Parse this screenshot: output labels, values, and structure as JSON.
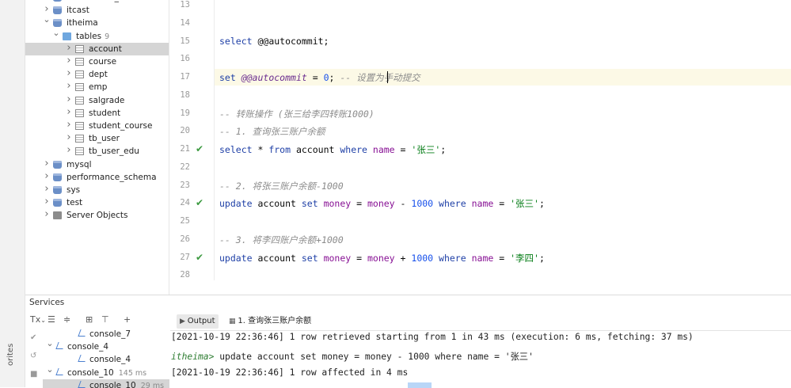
{
  "sidebar": {
    "favorites_label": "orites"
  },
  "db_tree": {
    "items": [
      {
        "label": "information_schema",
        "level": 1,
        "type": "db",
        "chevron": "›"
      },
      {
        "label": "itcast",
        "level": 1,
        "type": "db",
        "chevron": "›"
      },
      {
        "label": "itheima",
        "level": 1,
        "type": "db",
        "chevron": "⌄"
      },
      {
        "label": "tables",
        "count": "9",
        "level": 2,
        "type": "folder",
        "chevron": "⌄"
      },
      {
        "label": "account",
        "level": 3,
        "type": "table",
        "chevron": "›",
        "selected": true
      },
      {
        "label": "course",
        "level": 3,
        "type": "table",
        "chevron": "›"
      },
      {
        "label": "dept",
        "level": 3,
        "type": "table",
        "chevron": "›"
      },
      {
        "label": "emp",
        "level": 3,
        "type": "table",
        "chevron": "›"
      },
      {
        "label": "salgrade",
        "level": 3,
        "type": "table",
        "chevron": "›"
      },
      {
        "label": "student",
        "level": 3,
        "type": "table",
        "chevron": "›"
      },
      {
        "label": "student_course",
        "level": 3,
        "type": "table",
        "chevron": "›"
      },
      {
        "label": "tb_user",
        "level": 3,
        "type": "table",
        "chevron": "›"
      },
      {
        "label": "tb_user_edu",
        "level": 3,
        "type": "table",
        "chevron": "›"
      },
      {
        "label": "mysql",
        "level": 1,
        "type": "db",
        "chevron": "›"
      },
      {
        "label": "performance_schema",
        "level": 1,
        "type": "db",
        "chevron": "›"
      },
      {
        "label": "sys",
        "level": 1,
        "type": "db",
        "chevron": "›"
      },
      {
        "label": "test",
        "level": 1,
        "type": "db",
        "chevron": "›"
      },
      {
        "label": "Server Objects",
        "level": 1,
        "type": "server",
        "chevron": "›"
      }
    ]
  },
  "editor": {
    "lines": [
      {
        "n": "13",
        "check": false,
        "tokens": []
      },
      {
        "n": "14",
        "check": false,
        "tokens": []
      },
      {
        "n": "15",
        "check": false,
        "tokens": [
          {
            "t": "select ",
            "c": "kw"
          },
          {
            "t": "@@autocommit;",
            "c": ""
          }
        ]
      },
      {
        "n": "16",
        "check": false,
        "tokens": []
      },
      {
        "n": "17",
        "check": false,
        "tokens": [
          {
            "t": "set ",
            "c": "kw"
          },
          {
            "t": "@@autocommit",
            "c": "var"
          },
          {
            "t": " = ",
            "c": ""
          },
          {
            "t": "0",
            "c": "num"
          },
          {
            "t": "; ",
            "c": ""
          },
          {
            "t": "-- 设置为手动提交",
            "c": "cmt"
          }
        ]
      },
      {
        "n": "18",
        "check": false,
        "tokens": []
      },
      {
        "n": "19",
        "check": false,
        "tokens": [
          {
            "t": "-- 转账操作 (张三给李四转账1000)",
            "c": "cmt"
          }
        ]
      },
      {
        "n": "20",
        "check": false,
        "tokens": [
          {
            "t": "-- 1. 查询张三账户余额",
            "c": "cmt"
          }
        ]
      },
      {
        "n": "21",
        "check": true,
        "tokens": [
          {
            "t": "select",
            "c": "kw"
          },
          {
            "t": " * ",
            "c": ""
          },
          {
            "t": "from",
            "c": "kw"
          },
          {
            "t": " account ",
            "c": ""
          },
          {
            "t": "where",
            "c": "kw"
          },
          {
            "t": " ",
            "c": ""
          },
          {
            "t": "name",
            "c": "col"
          },
          {
            "t": " = ",
            "c": ""
          },
          {
            "t": "'张三'",
            "c": "str"
          },
          {
            "t": ";",
            "c": ""
          }
        ]
      },
      {
        "n": "22",
        "check": false,
        "tokens": []
      },
      {
        "n": "23",
        "check": false,
        "tokens": [
          {
            "t": "-- 2. 将张三账户余额-1000",
            "c": "cmt"
          }
        ]
      },
      {
        "n": "24",
        "check": true,
        "tokens": [
          {
            "t": "update",
            "c": "kw"
          },
          {
            "t": " account ",
            "c": ""
          },
          {
            "t": "set",
            "c": "kw"
          },
          {
            "t": " ",
            "c": ""
          },
          {
            "t": "money",
            "c": "col"
          },
          {
            "t": " = ",
            "c": ""
          },
          {
            "t": "money",
            "c": "col"
          },
          {
            "t": " - ",
            "c": ""
          },
          {
            "t": "1000",
            "c": "num"
          },
          {
            "t": " ",
            "c": ""
          },
          {
            "t": "where",
            "c": "kw"
          },
          {
            "t": " ",
            "c": ""
          },
          {
            "t": "name",
            "c": "col"
          },
          {
            "t": " = ",
            "c": ""
          },
          {
            "t": "'张三'",
            "c": "str"
          },
          {
            "t": ";",
            "c": ""
          }
        ]
      },
      {
        "n": "25",
        "check": false,
        "tokens": []
      },
      {
        "n": "26",
        "check": false,
        "tokens": [
          {
            "t": "-- 3. 将李四账户余额+1000",
            "c": "cmt"
          }
        ]
      },
      {
        "n": "27",
        "check": true,
        "tokens": [
          {
            "t": "update",
            "c": "kw"
          },
          {
            "t": " account ",
            "c": ""
          },
          {
            "t": "set",
            "c": "kw"
          },
          {
            "t": " ",
            "c": ""
          },
          {
            "t": "money",
            "c": "col"
          },
          {
            "t": " = ",
            "c": ""
          },
          {
            "t": "money",
            "c": "col"
          },
          {
            "t": " + ",
            "c": ""
          },
          {
            "t": "1000",
            "c": "num"
          },
          {
            "t": " ",
            "c": ""
          },
          {
            "t": "where",
            "c": "kw"
          },
          {
            "t": " ",
            "c": ""
          },
          {
            "t": "name",
            "c": "col"
          },
          {
            "t": " = ",
            "c": ""
          },
          {
            "t": "'李四'",
            "c": "str"
          },
          {
            "t": ";",
            "c": ""
          }
        ]
      },
      {
        "n": "28",
        "check": false,
        "tokens": []
      }
    ]
  },
  "services": {
    "title": "Services",
    "toolbar": {
      "tx": "Tx",
      "add": "+"
    },
    "tree": [
      {
        "label": "console_7",
        "time": "",
        "level": 2,
        "chevron": ""
      },
      {
        "label": "console_4",
        "time": "",
        "level": 1,
        "chevron": "⌄"
      },
      {
        "label": "console_4",
        "time": "",
        "level": 2,
        "chevron": ""
      },
      {
        "label": "console_10",
        "time": "145 ms",
        "level": 1,
        "chevron": "⌄"
      },
      {
        "label": "console_10",
        "time": "29 ms",
        "level": 2,
        "chevron": "",
        "selected": true
      }
    ],
    "tabs": [
      {
        "label": "Output",
        "active": true,
        "icon": "output-icon"
      },
      {
        "label": "1. 查询张三账户余额",
        "active": false,
        "icon": "table-icon"
      }
    ],
    "output": [
      {
        "prompt": "",
        "text": "[2021-10-19 22:36:46] 1 row retrieved starting from 1 in 43 ms (execution: 6 ms, fetching: 37 ms)"
      },
      {
        "prompt": "itheima>",
        "text": "update account set money = money - 1000 where name = '张三'"
      },
      {
        "prompt": "",
        "text": "[2021-10-19 22:36:46] 1 row affected in 4 ms"
      }
    ]
  }
}
